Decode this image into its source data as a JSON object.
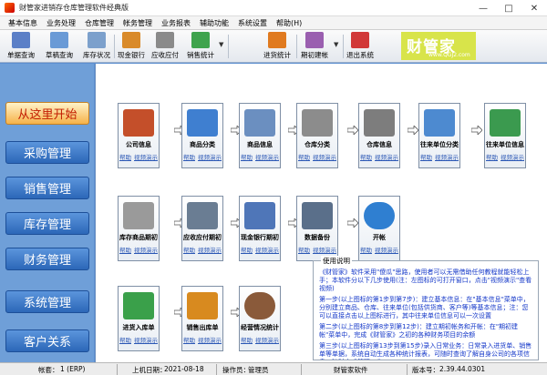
{
  "window": {
    "title": "财管家进销存仓库管理软件经典版"
  },
  "menu": [
    "基本信息",
    "业务处理",
    "仓库管理",
    "帐务管理",
    "业务报表",
    "辅助功能",
    "系统设置",
    "帮助(H)"
  ],
  "toolbar": [
    {
      "label": "单据查询",
      "icon": "magnifier-icon",
      "color": "#5b7fc7"
    },
    {
      "label": "草稿查询",
      "icon": "draft-search-icon",
      "color": "#6a9ad6"
    },
    {
      "label": "库存状况",
      "icon": "stock-status-icon",
      "color": "#7ca0cc"
    },
    {
      "label": "现金银行",
      "icon": "cash-bank-icon",
      "color": "#d98a2a"
    },
    {
      "label": "应收应付",
      "icon": "receivable-payable-icon",
      "color": "#8a8a8a"
    },
    {
      "label": "销售统计",
      "icon": "sales-stats-icon",
      "color": "#3fa34d"
    },
    {
      "label": "进货统计",
      "icon": "purchase-stats-icon",
      "color": "#e07a1f"
    },
    {
      "label": "期初建帐",
      "icon": "opening-account-icon",
      "color": "#9a5fb0"
    },
    {
      "label": "退出系统",
      "icon": "exit-icon",
      "color": "#d13838"
    }
  ],
  "brand": {
    "name": "财管家",
    "url": "www.QGJ2.com"
  },
  "sidebar": [
    "从这里开始",
    "采购管理",
    "销售管理",
    "库存管理",
    "财务管理",
    "系统管理",
    "客户关系"
  ],
  "cards": {
    "row1": [
      {
        "label": "公司信息",
        "icon": "company-info-icon",
        "color": "#c44f2a"
      },
      {
        "label": "商品分类",
        "icon": "product-category-icon",
        "color": "#3f7fd0"
      },
      {
        "label": "商品信息",
        "icon": "product-info-icon",
        "color": "#6b8fc0"
      },
      {
        "label": "仓库分类",
        "icon": "warehouse-category-icon",
        "color": "#8c8c8c"
      },
      {
        "label": "仓库信息",
        "icon": "warehouse-info-icon",
        "color": "#7d7d7d"
      },
      {
        "label": "往来单位分类",
        "icon": "partner-category-icon",
        "color": "#4d8ad0"
      },
      {
        "label": "往来单位信息",
        "icon": "partner-info-icon",
        "color": "#3b9a4f"
      }
    ],
    "row2": [
      {
        "label": "库存商品期初",
        "icon": "opening-stock-icon",
        "color": "#9a9a9a"
      },
      {
        "label": "应收应付期初",
        "icon": "opening-receivable-icon",
        "color": "#6a7d93"
      },
      {
        "label": "现金银行期初",
        "icon": "opening-cash-icon",
        "color": "#4f76b8"
      },
      {
        "label": "数据备份",
        "icon": "data-backup-icon",
        "color": "#5a6f8a"
      },
      {
        "label": "开帐",
        "icon": "open-account-icon",
        "color": "#2f7fd1"
      }
    ],
    "row3": [
      {
        "label": "进货入库单",
        "icon": "purchase-inbound-icon",
        "color": "#3aa04a"
      },
      {
        "label": "销售出库单",
        "icon": "sales-outbound-icon",
        "color": "#d88a1f"
      },
      {
        "label": "经营情况统计",
        "icon": "business-stats-icon",
        "color": "#8a5a3a"
      }
    ],
    "link_help": "帮助",
    "link_video": "视频演示"
  },
  "usage": {
    "title": "使用说明",
    "paragraphs": [
      "《财管家》软件采用\"傻瓜\"思路，使用者可以无需借助任何教程就能轻松上手；本软件分以下几步使用(注：左图标的可打开窗口，点击\"视频演示\"查看视频)",
      "第一步(以上图标的第1步到第7步)：建立基本信息：在\"基本信息\"菜单中，分别建立商品、仓库、往来单位(包括供货商、客户等)等基本信息；注：您可以直接点击以上图标进行，其中往来单位信息可以一次设置",
      "第二步(以上图标的第8步到第12步)：建立期初帐务和开帐：在\"期初建帐\"菜单中，完成《财管家》之初的各种财务项目的余额",
      "第三步(以上图标的第13步到第15步)录入日常业务：日常录入进货单、销售单等单据，系统自动生成各种统计报表，可随时查询了解自身公司的各项信息，随时完成管理工作"
    ]
  },
  "status": {
    "account_label": "帐套：",
    "account_value": "1  (ERP)",
    "date_label": "上机日期：",
    "date_value": "2021-08-18",
    "operator_label": "操作员：",
    "operator_value": "管理员",
    "product": "财管家软件",
    "version_label": "版本号：",
    "version_value": "2.39.44.0301"
  }
}
